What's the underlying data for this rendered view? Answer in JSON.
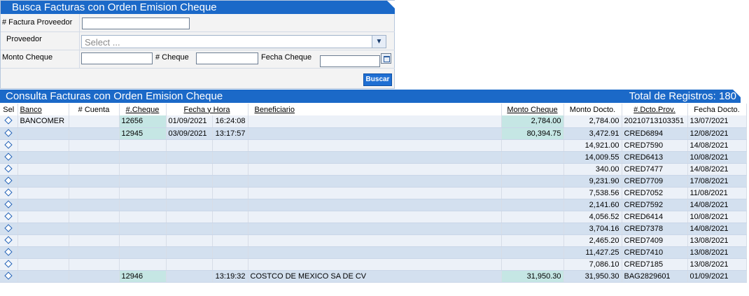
{
  "search": {
    "title": "Busca Facturas con Orden Emision Cheque",
    "factura_label": "# Factura Proveedor",
    "factura_value": "",
    "proveedor_label": "Proveedor",
    "proveedor_placeholder": "Select ...",
    "monto_label": "Monto Cheque",
    "monto_value": "",
    "cheque_label": "# Cheque",
    "cheque_value": "",
    "fecha_label": "Fecha Cheque",
    "fecha_value": "",
    "buscar_label": "Buscar"
  },
  "results": {
    "title": "Consulta Facturas con Orden Emision Cheque",
    "total_label": "Total de Registros: 180",
    "columns": [
      "Sel",
      "Banco",
      "# Cuenta",
      "#.Cheque",
      "Fecha y Hora",
      "",
      "Beneficiario",
      "Monto Cheque",
      "Monto Docto.",
      "#.Dcto.Prov.",
      "Fecha Docto."
    ],
    "rows": [
      {
        "banco": "BANCOMER",
        "cuenta": "",
        "cheque": "12656",
        "fecha": "01/09/2021",
        "hora": "16:24:08",
        "beneficiario": "",
        "monto_cheque": "2,784.00",
        "monto_docto": "2,784.00",
        "dcto_prov": "20210713103351",
        "fecha_docto": "13/07/2021"
      },
      {
        "banco": "",
        "cuenta": "",
        "cheque": "12945",
        "fecha": "03/09/2021",
        "hora": "13:17:57",
        "beneficiario": "",
        "monto_cheque": "80,394.75",
        "monto_docto": "3,472.91",
        "dcto_prov": "CRED6894",
        "fecha_docto": "12/08/2021"
      },
      {
        "banco": "",
        "cuenta": "",
        "cheque": "",
        "fecha": "",
        "hora": "",
        "beneficiario": "",
        "monto_cheque": "",
        "monto_docto": "14,921.00",
        "dcto_prov": "CRED7590",
        "fecha_docto": "14/08/2021"
      },
      {
        "banco": "",
        "cuenta": "",
        "cheque": "",
        "fecha": "",
        "hora": "",
        "beneficiario": "",
        "monto_cheque": "",
        "monto_docto": "14,009.55",
        "dcto_prov": "CRED6413",
        "fecha_docto": "10/08/2021"
      },
      {
        "banco": "",
        "cuenta": "",
        "cheque": "",
        "fecha": "",
        "hora": "",
        "beneficiario": "",
        "monto_cheque": "",
        "monto_docto": "340.00",
        "dcto_prov": "CRED7477",
        "fecha_docto": "14/08/2021"
      },
      {
        "banco": "",
        "cuenta": "",
        "cheque": "",
        "fecha": "",
        "hora": "",
        "beneficiario": "",
        "monto_cheque": "",
        "monto_docto": "9,231.90",
        "dcto_prov": "CRED7709",
        "fecha_docto": "17/08/2021"
      },
      {
        "banco": "",
        "cuenta": "",
        "cheque": "",
        "fecha": "",
        "hora": "",
        "beneficiario": "",
        "monto_cheque": "",
        "monto_docto": "7,538.56",
        "dcto_prov": "CRED7052",
        "fecha_docto": "11/08/2021"
      },
      {
        "banco": "",
        "cuenta": "",
        "cheque": "",
        "fecha": "",
        "hora": "",
        "beneficiario": "",
        "monto_cheque": "",
        "monto_docto": "2,141.60",
        "dcto_prov": "CRED7592",
        "fecha_docto": "14/08/2021"
      },
      {
        "banco": "",
        "cuenta": "",
        "cheque": "",
        "fecha": "",
        "hora": "",
        "beneficiario": "",
        "monto_cheque": "",
        "monto_docto": "4,056.52",
        "dcto_prov": "CRED6414",
        "fecha_docto": "10/08/2021"
      },
      {
        "banco": "",
        "cuenta": "",
        "cheque": "",
        "fecha": "",
        "hora": "",
        "beneficiario": "",
        "monto_cheque": "",
        "monto_docto": "3,704.16",
        "dcto_prov": "CRED7378",
        "fecha_docto": "14/08/2021"
      },
      {
        "banco": "",
        "cuenta": "",
        "cheque": "",
        "fecha": "",
        "hora": "",
        "beneficiario": "",
        "monto_cheque": "",
        "monto_docto": "2,465.20",
        "dcto_prov": "CRED7409",
        "fecha_docto": "13/08/2021"
      },
      {
        "banco": "",
        "cuenta": "",
        "cheque": "",
        "fecha": "",
        "hora": "",
        "beneficiario": "",
        "monto_cheque": "",
        "monto_docto": "11,427.25",
        "dcto_prov": "CRED7410",
        "fecha_docto": "13/08/2021"
      },
      {
        "banco": "",
        "cuenta": "",
        "cheque": "",
        "fecha": "",
        "hora": "",
        "beneficiario": "",
        "monto_cheque": "",
        "monto_docto": "7,086.10",
        "dcto_prov": "CRED7185",
        "fecha_docto": "13/08/2021"
      },
      {
        "banco": "",
        "cuenta": "",
        "cheque": "12946",
        "fecha": "",
        "hora": "13:19:32",
        "beneficiario": "COSTCO DE MEXICO SA DE CV",
        "monto_cheque": "31,950.30",
        "monto_docto": "31,950.30",
        "dcto_prov": "BAG2829601",
        "fecha_docto": "01/09/2021"
      }
    ]
  },
  "colors": {
    "header_blue": "#1b69c8",
    "row_light": "#ecf1f8",
    "row_dark": "#d3e0ef",
    "highlight": "#c5e6e4"
  },
  "icons": {
    "select_row": "diamond-select-icon",
    "calendar": "calendar-icon",
    "dropdown": "chevron-down-icon"
  }
}
